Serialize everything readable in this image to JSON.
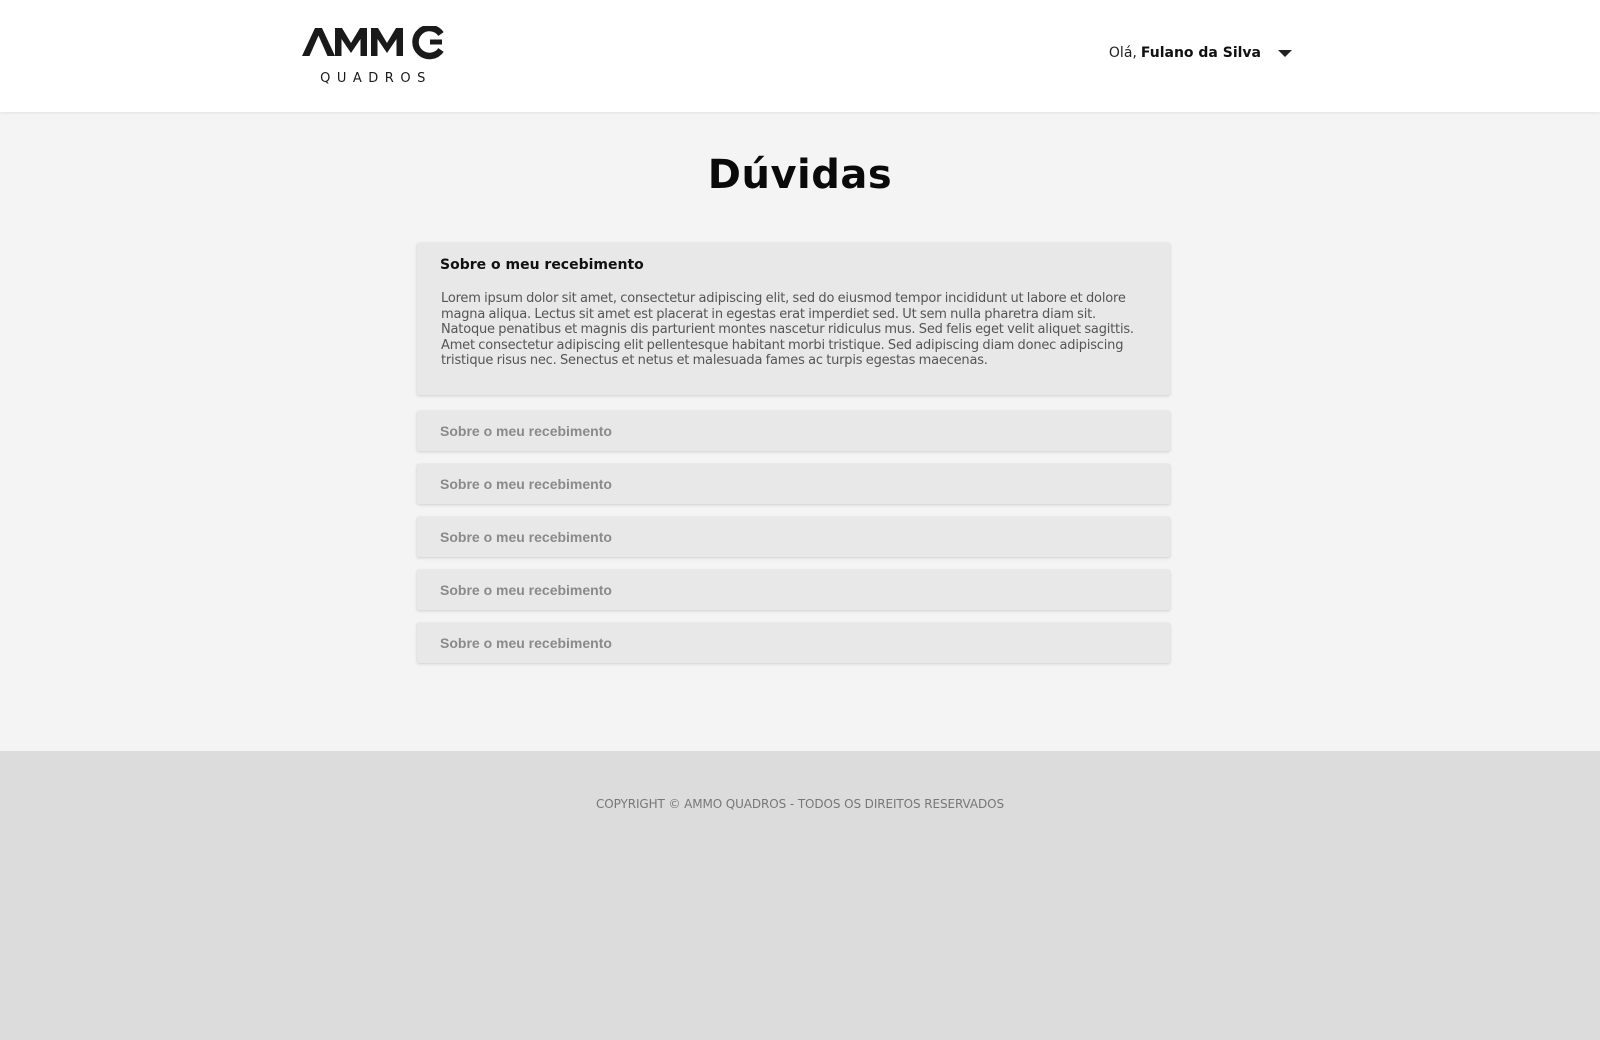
{
  "header": {
    "logo_main": "AMMO",
    "logo_sub": "QUADROS",
    "greeting": "Olá,",
    "user_name": "Fulano da Silva"
  },
  "main": {
    "title": "Dúvidas",
    "faq": [
      {
        "question": "Sobre o meu recebimento",
        "answer": "Lorem ipsum dolor sit amet, consectetur adipiscing elit, sed do eiusmod tempor incididunt ut labore et dolore magna aliqua. Lectus sit amet est placerat in egestas erat imperdiet sed. Ut sem nulla pharetra diam sit. Natoque penatibus et magnis dis parturient montes nascetur ridiculus mus. Sed felis eget velit aliquet sagittis. Amet consectetur adipiscing elit pellentesque habitant morbi tristique. Sed adipiscing diam donec adipiscing tristique risus nec. Senectus et netus et malesuada fames ac turpis egestas maecenas.",
        "expanded": true
      },
      {
        "question": "Sobre o meu recebimento",
        "expanded": false
      },
      {
        "question": "Sobre o meu recebimento",
        "expanded": false
      },
      {
        "question": "Sobre o meu recebimento",
        "expanded": false
      },
      {
        "question": "Sobre o meu recebimento",
        "expanded": false
      },
      {
        "question": "Sobre o meu recebimento",
        "expanded": false
      }
    ]
  },
  "footer": {
    "copyright": "COPYRIGHT © AMMO QUADROS - TODOS OS DIREITOS RESERVADOS"
  },
  "colors": {
    "page_bg": "#f4f4f4",
    "header_bg": "#ffffff",
    "card_bg": "#e8e8e8",
    "footer_bg": "#dcdcdc",
    "muted_text": "#8a8a8a"
  },
  "icons": {
    "user_menu": "caret-down-icon"
  }
}
